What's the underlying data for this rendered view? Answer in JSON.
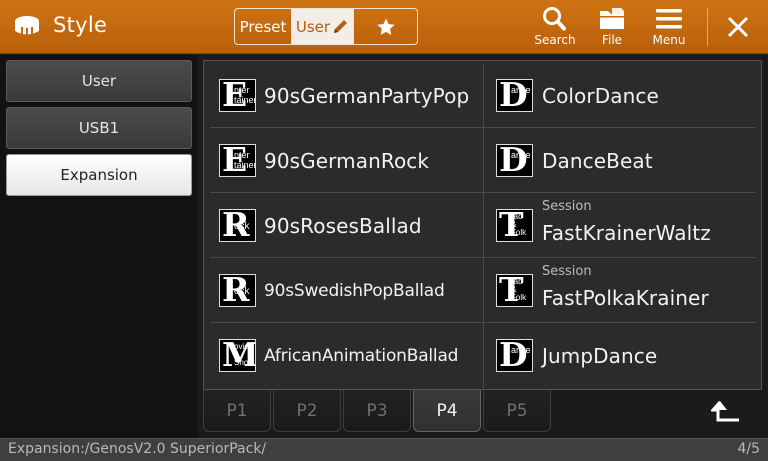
{
  "header": {
    "title": "Style",
    "icon": "style-icon",
    "accent_color": "#c76a10",
    "segments": {
      "preset": "Preset",
      "user": "User",
      "favorite_icon": "star-icon"
    },
    "tools": {
      "search": "Search",
      "file": "File",
      "menu": "Menu"
    },
    "close_icon": "close-icon"
  },
  "sidebar": {
    "items": [
      {
        "label": "User",
        "active": false
      },
      {
        "label": "USB1",
        "active": false
      },
      {
        "label": "Expansion",
        "active": true
      }
    ]
  },
  "list": {
    "items": [
      {
        "category": "Entertainer",
        "icon_letter": "E",
        "icon_text": "nter\ntainer",
        "name": "90sGermanPartyPop",
        "sub": ""
      },
      {
        "category": "Dance",
        "icon_letter": "D",
        "icon_text": "ance",
        "name": "ColorDance",
        "sub": ""
      },
      {
        "category": "Entertainer",
        "icon_letter": "E",
        "icon_text": "nter\ntainer",
        "name": "90sGermanRock",
        "sub": ""
      },
      {
        "category": "Dance",
        "icon_letter": "D",
        "icon_text": "ance",
        "name": "DanceBeat",
        "sub": ""
      },
      {
        "category": "Rock",
        "icon_letter": "R",
        "icon_text": "ock",
        "name": "90sRosesBallad",
        "sub": ""
      },
      {
        "category": "Trad & Folk",
        "icon_letter": "T",
        "icon_text": "rad\n&\nFolk",
        "name": "FastKrainerWaltz",
        "sub": "Session"
      },
      {
        "category": "Rock",
        "icon_letter": "R",
        "icon_text": "ock",
        "name": "90sSwedishPopBallad",
        "sub": ""
      },
      {
        "category": "Trad & Folk",
        "icon_letter": "T",
        "icon_text": "rad\n&\nFolk",
        "name": "FastPolkaKrainer",
        "sub": "Session"
      },
      {
        "category": "Movie & Show",
        "icon_letter": "M",
        "icon_text": "ovie\n&\nShow",
        "name": "AfricanAnimationBallad",
        "sub": ""
      },
      {
        "category": "Dance",
        "icon_letter": "D",
        "icon_text": "ance",
        "name": "JumpDance",
        "sub": ""
      }
    ]
  },
  "pages": {
    "tabs": [
      "P1",
      "P2",
      "P3",
      "P4",
      "P5"
    ],
    "active": "P4",
    "up_icon": "up-arrow-icon"
  },
  "status": {
    "path": "Expansion:/GenosV2.0 SuperiorPack/",
    "page_info": "4/5"
  }
}
